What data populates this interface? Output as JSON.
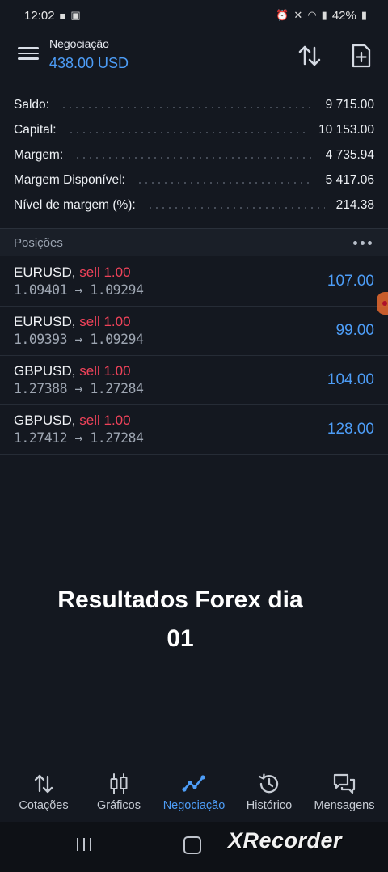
{
  "status_bar": {
    "time": "12:02",
    "battery": "42%"
  },
  "app_bar": {
    "title": "Negociação",
    "balance": "438.00 USD"
  },
  "summary": [
    {
      "label": "Saldo:",
      "value": "9 715.00"
    },
    {
      "label": "Capital:",
      "value": "10 153.00"
    },
    {
      "label": "Margem:",
      "value": "4 735.94"
    },
    {
      "label": "Margem Disponível:",
      "value": "5 417.06"
    },
    {
      "label": "Nível de margem (%):",
      "value": "214.38"
    }
  ],
  "positions_section": {
    "title": "Posições"
  },
  "positions": [
    {
      "symbol": "EURUSD,",
      "side": "sell 1.00",
      "prices": "1.09401 → 1.09294",
      "profit": "107.00"
    },
    {
      "symbol": "EURUSD,",
      "side": "sell 1.00",
      "prices": "1.09393 → 1.09294",
      "profit": "99.00"
    },
    {
      "symbol": "GBPUSD,",
      "side": "sell 1.00",
      "prices": "1.27388 → 1.27284",
      "profit": "104.00"
    },
    {
      "symbol": "GBPUSD,",
      "side": "sell 1.00",
      "prices": "1.27412 → 1.27284",
      "profit": "128.00"
    }
  ],
  "overlay": {
    "line1": "Resultados Forex dia",
    "line2": "01"
  },
  "bottom_nav": [
    {
      "label": "Cotações",
      "icon": "sort-arrows-icon"
    },
    {
      "label": "Gráficos",
      "icon": "candlestick-icon"
    },
    {
      "label": "Negociação",
      "icon": "trend-line-icon",
      "active": true
    },
    {
      "label": "Histórico",
      "icon": "history-icon"
    },
    {
      "label": "Mensagens",
      "icon": "chat-icon"
    }
  ],
  "watermark": "XRecorder",
  "colors": {
    "background": "#141820",
    "accent": "#4d9df7",
    "sell": "#f0435a"
  }
}
